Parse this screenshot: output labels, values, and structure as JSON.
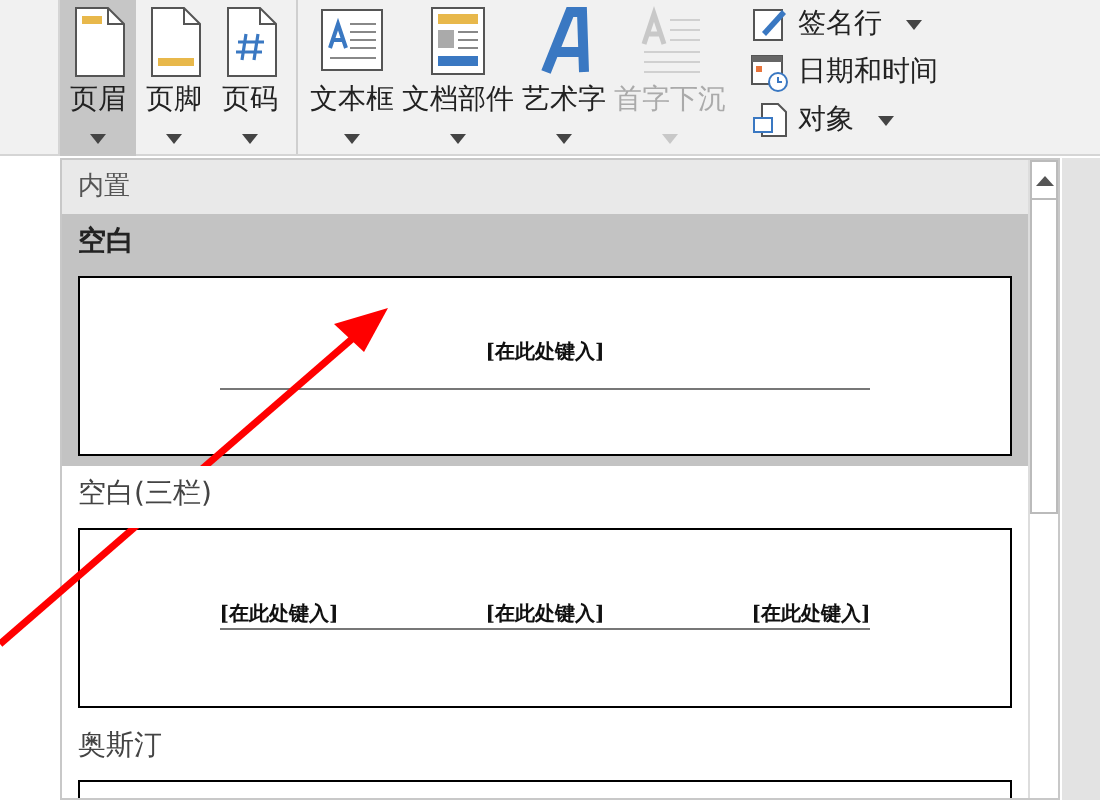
{
  "ribbon": {
    "buttons": [
      {
        "label": "页眉",
        "kind": "header",
        "selected": true,
        "disabled": false,
        "dropdown": true
      },
      {
        "label": "页脚",
        "kind": "footer",
        "selected": false,
        "disabled": false,
        "dropdown": true
      },
      {
        "label": "页码",
        "kind": "page-number",
        "selected": false,
        "disabled": false,
        "dropdown": true
      },
      {
        "label": "文本框",
        "kind": "textbox",
        "selected": false,
        "disabled": false,
        "dropdown": true
      },
      {
        "label": "文档部件",
        "kind": "parts",
        "selected": false,
        "disabled": false,
        "dropdown": true
      },
      {
        "label": "艺术字",
        "kind": "wordart",
        "selected": false,
        "disabled": false,
        "dropdown": true
      },
      {
        "label": "首字下沉",
        "kind": "dropcap",
        "selected": false,
        "disabled": true,
        "dropdown": true
      }
    ],
    "small_buttons": [
      {
        "label": "签名行",
        "kind": "signature",
        "dropdown": true
      },
      {
        "label": "日期和时间",
        "kind": "datetime",
        "dropdown": false
      },
      {
        "label": "对象",
        "kind": "object",
        "dropdown": true
      }
    ]
  },
  "gallery": {
    "section": "内置",
    "items": [
      {
        "name": "空白",
        "selected": true,
        "placeholders": [
          "[在此处键入]"
        ]
      },
      {
        "name": "空白(三栏)",
        "selected": false,
        "placeholders": [
          "[在此处键入]",
          "[在此处键入]",
          "[在此处键入]"
        ]
      },
      {
        "name": "奥斯汀",
        "selected": false
      }
    ]
  }
}
